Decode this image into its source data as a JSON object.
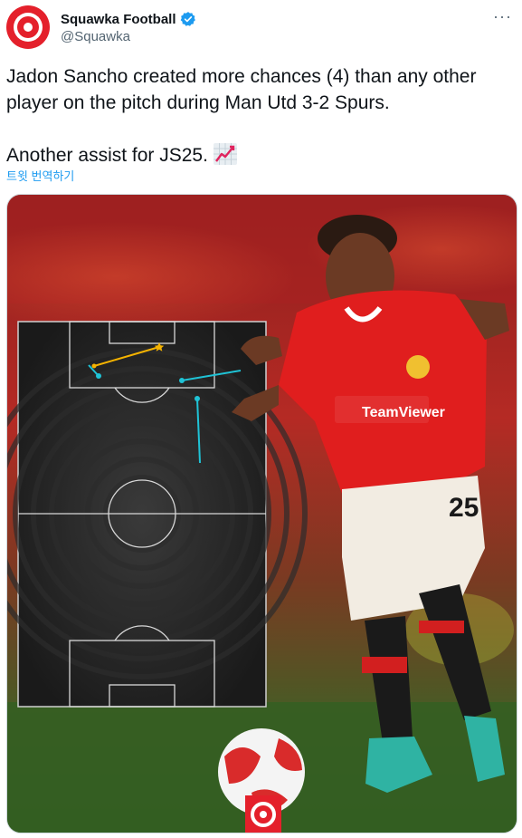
{
  "author": {
    "display_name": "Squawka Football",
    "handle": "@Squawka",
    "avatar_icon": "squawka-logo-icon",
    "verified_icon": "verified-badge-icon",
    "brand_color": "#e4202b"
  },
  "menu_icon": "more-options-icon",
  "tweet": {
    "line1": "Jadon Sancho created more chances (4) than any other player on the pitch during Man Utd 3-2 Spurs.",
    "line2": "Another assist for JS25.",
    "emoji": "chart-increasing-icon"
  },
  "translate_link": "트윗 번역하기",
  "media": {
    "jersey_number": "25",
    "sponsor": "TeamViewer",
    "pitch": {
      "chance_count": 4,
      "assist_color": "#f5b300",
      "key_pass_color": "#1fc3d6"
    }
  }
}
